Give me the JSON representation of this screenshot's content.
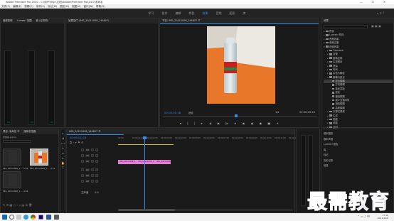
{
  "app": {
    "title": "Adobe Premiere Pro 2020 - C:\\用户\\Rl\\jc\\文档\\Adobe\\Premiere Pro\\14.0\\未命名"
  },
  "menu": [
    "文件(F)",
    "编辑(E)",
    "剪辑(C)",
    "序列(S)",
    "标记(M)",
    "图形(G)",
    "视图(V)",
    "窗口(W)",
    "帮助(H)"
  ],
  "workspaces": [
    {
      "label": "学习",
      "active": false
    },
    {
      "label": "组件",
      "active": false
    },
    {
      "label": "编辑",
      "active": false
    },
    {
      "label": "颜色",
      "active": false
    },
    {
      "label": "效果",
      "active": true
    },
    {
      "label": "音频",
      "active": false
    },
    {
      "label": "图形",
      "active": false
    },
    {
      "label": "库",
      "active": false
    }
  ],
  "audio_panel": {
    "tabs": [
      "音频剪辑",
      "Lumetri 范围",
      "音 (无剪辑)"
    ]
  },
  "effect_controls": {
    "tab": "效果控件 (IMG_20211008_144807)"
  },
  "program_monitor": {
    "tab": "节目: IMG_20211008_144807 ☰",
    "timecode_left": "00:00:01:18",
    "fit_label": "适合",
    "scale_label": "1/2",
    "timecode_right": "00:00:03:16"
  },
  "effects_panel": {
    "title": "效果",
    "items": [
      {
        "label": "预设",
        "level": 0,
        "expanded": false,
        "selected": false
      },
      {
        "label": "Lumetri 预设",
        "level": 0,
        "expanded": false,
        "selected": false
      },
      {
        "label": "音频效果",
        "level": 0,
        "expanded": false,
        "selected": false
      },
      {
        "label": "音频过渡",
        "level": 0,
        "expanded": false,
        "selected": false
      },
      {
        "label": "视频效果",
        "level": 0,
        "expanded": true,
        "selected": false
      },
      {
        "label": "Obsolete",
        "level": 1,
        "expanded": false,
        "selected": false
      },
      {
        "label": "变换",
        "level": 1,
        "expanded": false,
        "selected": false
      },
      {
        "label": "图像控制",
        "level": 1,
        "expanded": false,
        "selected": false
      },
      {
        "label": "实用程序",
        "level": 1,
        "expanded": false,
        "selected": false
      },
      {
        "label": "扭曲",
        "level": 1,
        "expanded": false,
        "selected": false
      },
      {
        "label": "时间",
        "level": 1,
        "expanded": false,
        "selected": false
      },
      {
        "label": "杂色与颗粒",
        "level": 1,
        "expanded": false,
        "selected": false
      },
      {
        "label": "模糊与锐化",
        "level": 1,
        "expanded": true,
        "selected": false
      },
      {
        "label": "复合模糊",
        "level": 2,
        "expanded": false,
        "selected": true
      },
      {
        "label": "方向模糊",
        "level": 2,
        "expanded": false,
        "selected": false
      },
      {
        "label": "钝化蒙版",
        "level": 2,
        "expanded": false,
        "selected": false
      },
      {
        "label": "锐化",
        "level": 2,
        "expanded": false,
        "selected": false
      },
      {
        "label": "通道模糊",
        "level": 2,
        "expanded": false,
        "selected": false
      },
      {
        "label": "减少交错闪烁",
        "level": 2,
        "expanded": false,
        "selected": false
      },
      {
        "label": "相机模糊",
        "level": 2,
        "expanded": false,
        "selected": false
      },
      {
        "label": "高斯模糊",
        "level": 2,
        "expanded": false,
        "selected": false
      },
      {
        "label": "沉浸式视频",
        "level": 1,
        "expanded": false,
        "selected": false
      },
      {
        "label": "生成",
        "level": 1,
        "expanded": false,
        "selected": false
      },
      {
        "label": "视频",
        "level": 1,
        "expanded": false,
        "selected": false
      },
      {
        "label": "调整",
        "level": 1,
        "expanded": false,
        "selected": false
      },
      {
        "label": "过时",
        "level": 1,
        "expanded": false,
        "selected": false
      }
    ]
  },
  "right_lower": {
    "items": [
      "基本图形",
      "基本声音",
      "Lumetri 颜色",
      "库",
      "标记",
      "历史记录",
      "信息"
    ]
  },
  "project_panel": {
    "tabs": [
      "项目: 未命名 ☰",
      "媒体浏览器"
    ],
    "path": "未命名.prproj",
    "clips": [
      {
        "name": "IMG_20211008_1...",
        "duration": "3:16"
      },
      {
        "name": "IMG_20211008_1...",
        "duration": "3:12"
      },
      {
        "name": "IMG_20211008_1...",
        "duration": "4:04"
      }
    ]
  },
  "timeline": {
    "tab": "IMG_20211008_144807 ☰",
    "timecode": "00:00:01:18",
    "ruler": [
      "00:00",
      "00:00:01:00",
      "00:00:02:00",
      "00:00:03:00",
      "00:00:04:00",
      "00:00:05:00",
      "00:00:06:00",
      "00:00:07:00",
      "00:00:08:00",
      "00:00:09:00",
      "00:00:10:00",
      "00:00:11:00",
      "00:00:12:00"
    ],
    "tracks": [
      {
        "label": "V3"
      },
      {
        "label": "V2"
      },
      {
        "label": "V1"
      },
      {
        "label": "A1"
      },
      {
        "label": "A2"
      },
      {
        "label": "A3"
      }
    ],
    "master_label": "主声道",
    "master_value": "0.0",
    "clips": [
      {
        "track": "V1",
        "name": "IMG_20211008_1"
      },
      {
        "track": "V1",
        "name": "IMG_20211008_1"
      },
      {
        "track": "V1",
        "name": "IMG_20211008_14"
      }
    ]
  },
  "taskbar": {
    "time": "17:18",
    "date": "2021/10/8"
  },
  "watermark": {
    "text": "最需教育"
  },
  "colors": {
    "accent": "#2d8ceb",
    "clip": "#e37fd6",
    "watermark": "#3e5fd6"
  }
}
